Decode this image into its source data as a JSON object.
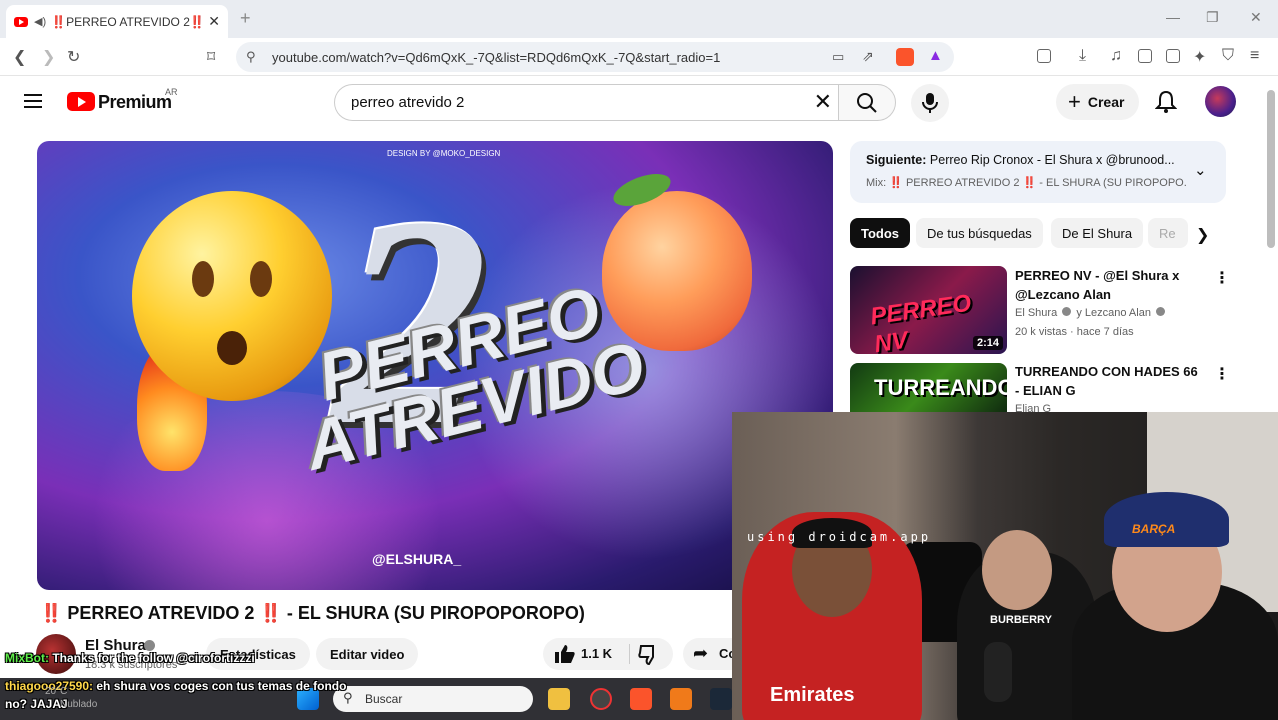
{
  "browser": {
    "tab_title": "‼️PERREO ATREVIDO 2‼️ - EL SHURA",
    "url": "youtube.com/watch?v=Qd6mQxK_-7Q&list=RDQd6mQxK_-7Q&start_radio=1"
  },
  "youtube": {
    "brand": "Premium",
    "country": "AR",
    "search_value": "perreo atrevido 2",
    "create_label": "Crear"
  },
  "thumbnail": {
    "title_text": "PERREO ATREVIDO",
    "big_number": "2",
    "handle": "@ELSHURA_",
    "design_credit": "DESIGN BY @MOKO_DESIGN"
  },
  "video": {
    "title": "‼️ PERREO ATREVIDO 2 ‼️ - EL SHURA (SU PIROPOPOROPO)",
    "channel_name": "El Shura",
    "channel_subs": "18.3 k suscriptores",
    "stats_button": "Estadísticas",
    "edit_button": "Editar video",
    "likes": "1.1 K",
    "share_label": "Co"
  },
  "sidebar": {
    "next_label": "Siguiente:",
    "next_title": "Perreo Rip Cronox - El Shura x @brunood...",
    "mix_line": "Mix: ‼️ PERREO ATREVIDO 2 ‼️ - EL SHURA (SU PIROPOPO...",
    "chips": [
      "Todos",
      "De tus búsquedas",
      "De El Shura",
      "Re"
    ],
    "recommendations": [
      {
        "title": "PERREO NV - @El Shura x @Lezcano Alan",
        "channel": "El Shura",
        "channel_extra": "y Lezcano Alan",
        "meta": "20 k vistas · hace 7 días",
        "duration": "2:14",
        "thumb_text": "PERREO NV"
      },
      {
        "title": "TURREANDO CON HADES 66 - ELIAN G",
        "channel": "Elian G",
        "thumb_text": "TURREANDO"
      }
    ]
  },
  "webcam": {
    "watermark": "using droidcam.app",
    "shirt_text": "BURBERRY",
    "cap_text": "BARÇA",
    "jersey_text": "Emirates"
  },
  "taskbar": {
    "search_label": "Buscar"
  },
  "chat": {
    "line1_user": "MixBot:",
    "line1_text": "Thanks for the follow @cirofortizzzi",
    "line2_user": "thiagooo27590:",
    "line2_text": "eh shura vos coges con tus temas de fondo",
    "line3_text": "no? JAJAJ",
    "faded": "Nublado",
    "temp": "20°C"
  },
  "colors": {
    "yt_red": "#ff0000",
    "chip_active": "#0f0f0f",
    "title_bang": "#e60026"
  }
}
